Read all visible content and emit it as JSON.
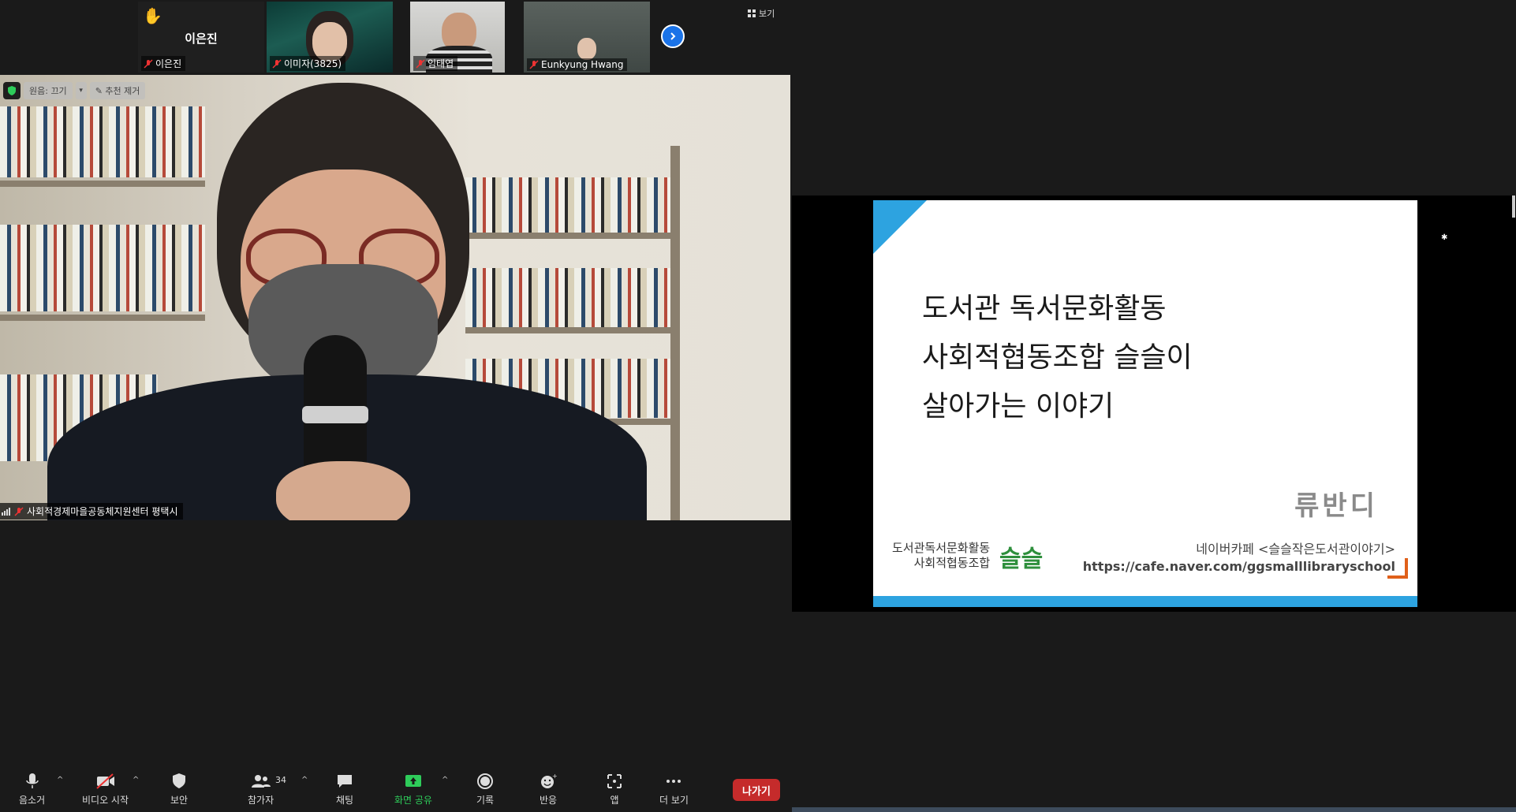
{
  "top_strip": {
    "self_tile": {
      "display_name": "이은진",
      "name_label": "이은진"
    },
    "participants": [
      {
        "name": "이미자(3825)"
      },
      {
        "name": "임태엽"
      },
      {
        "name": "Eunkyung Hwang"
      }
    ],
    "view_label": "보기"
  },
  "main_video": {
    "original_sound_label": "원음: 끄기",
    "remove_spotlight_label": "추천 제거",
    "speaker_name": "사회적경제마을공동체지원센터 평택시"
  },
  "toolbar": {
    "items": [
      {
        "label": "음소거"
      },
      {
        "label": "비디오 시작"
      },
      {
        "label": "보안"
      },
      {
        "label": "참가자",
        "count": "34"
      },
      {
        "label": "채팅"
      },
      {
        "label": "화면 공유"
      },
      {
        "label": "기록"
      },
      {
        "label": "반응"
      },
      {
        "label": "앱"
      },
      {
        "label": "더 보기"
      }
    ],
    "leave_label": "나가기"
  },
  "shared_slide": {
    "lines": [
      "도서관 독서문화활동",
      "사회적협동조합 슬슬이",
      "살아가는 이야기"
    ],
    "author": "류반디",
    "org_line1": "도서관독서문화활동",
    "org_line2": "사회적협동조합",
    "logo_text": "슬슬",
    "cafe_line": "네이버카페 <슬슬작은도서관이야기>",
    "cafe_url": "https://cafe.naver.com/ggsmalllibraryschool"
  },
  "colors": {
    "accent_blue": "#2da3e0",
    "share_green": "#2ecc5a",
    "leave_red": "#c52b2b"
  }
}
